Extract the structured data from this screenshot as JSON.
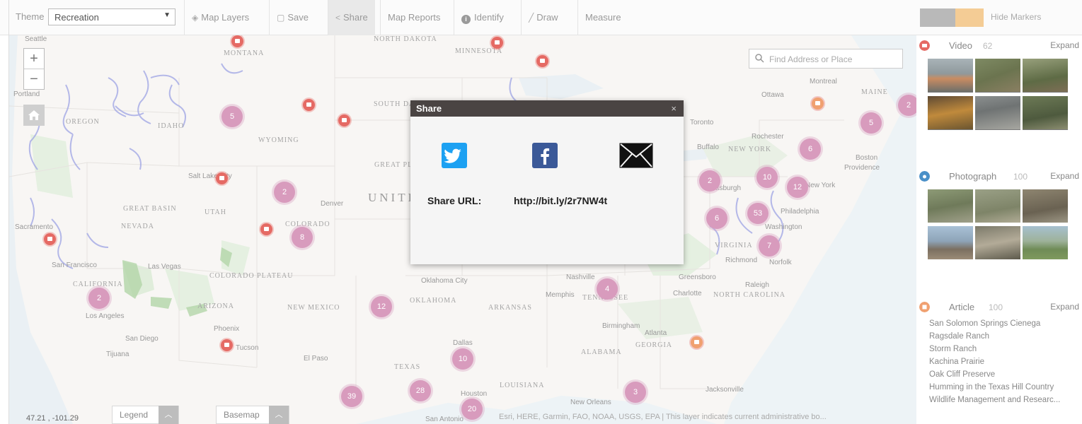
{
  "toolbar": {
    "theme_label": "Theme",
    "theme_value": "Recreation",
    "buttons": {
      "map_layers": "Map Layers",
      "save": "Save",
      "share": "Share",
      "map_reports": "Map Reports",
      "identify": "Identify",
      "draw": "Draw",
      "measure": "Measure"
    },
    "hide_markers": "Hide Markers",
    "toggle_colors": {
      "left": "#b9b9b9",
      "right": "#f4cc95"
    }
  },
  "map": {
    "search_placeholder": "Find Address or Place",
    "coordinates": "47.21 , -101.29",
    "legend_label": "Legend",
    "basemap_label": "Basemap",
    "attribution": "Esri, HERE, Garmin, FAO, NOAA, USGS, EPA | This layer indicates current administrative bo...",
    "clusters": [
      "5",
      "2",
      "8",
      "2",
      "12",
      "10",
      "39",
      "28",
      "20",
      "4",
      "3",
      "6",
      "10",
      "2",
      "12",
      "6",
      "53",
      "7",
      "5",
      "2"
    ],
    "state_labels": [
      "MONTANA",
      "IDAHO",
      "WYOMING",
      "UTAH",
      "COLORADO",
      "NEW MEXICO",
      "ARIZONA",
      "CALIFORNIA",
      "NEVADA",
      "OREGON",
      "NORTH DAKOTA",
      "SOUTH DAKOTA",
      "MINNESOTA",
      "OKLAHOMA",
      "ARKANSAS",
      "TEXAS",
      "LOUISIANA",
      "ALABAMA",
      "GEORGIA",
      "TENNESSEE",
      "NORTH CAROLINA",
      "VIRGINIA",
      "NEW YORK",
      "MAINE",
      "COLORADO PLATEAU",
      "GREAT BASIN",
      "GREAT PLAINS"
    ],
    "city_labels": [
      "Denver",
      "Salt Lake City",
      "Sacramento",
      "San Francisco",
      "Las Vegas",
      "Los Angeles",
      "San Diego",
      "Tijuana",
      "Phoenix",
      "Tucson",
      "El Paso",
      "Dallas",
      "Houston",
      "San Antonio",
      "Oklahoma City",
      "Nashville",
      "Memphis",
      "Atlanta",
      "Birmingham",
      "Charlotte",
      "Raleigh",
      "Greensboro",
      "Richmond",
      "Norfolk",
      "Washington",
      "Philadelphia",
      "New York",
      "Boston",
      "Providence",
      "Buffalo",
      "Rochester",
      "Toronto",
      "Ottawa",
      "Montreal",
      "Jacksonville",
      "New Orleans",
      "Portland",
      "Seattle",
      "Pittsburgh"
    ],
    "big_label": "UNITED STATES"
  },
  "share": {
    "title": "Share",
    "close": "×",
    "url_label": "Share URL:",
    "url": "http://bit.ly/2r7NW4t",
    "icons": [
      "twitter-icon",
      "facebook-icon",
      "email-icon"
    ]
  },
  "panel": {
    "video": {
      "title": "Video",
      "count": "62",
      "expand": "Expand",
      "color": "#e56a64"
    },
    "photograph": {
      "title": "Photograph",
      "count": "100",
      "expand": "Expand",
      "color": "#4a90c8"
    },
    "article": {
      "title": "Article",
      "count": "100",
      "expand": "Expand",
      "color": "#f0a070"
    },
    "articles": [
      "San Solomon Springs Cienega",
      "Ragsdale Ranch",
      "Storm Ranch",
      "Kachina Prairie",
      "Oak Cliff Preserve",
      "Humming in the Texas Hill Country",
      "Wildlife Management and Researc..."
    ]
  }
}
